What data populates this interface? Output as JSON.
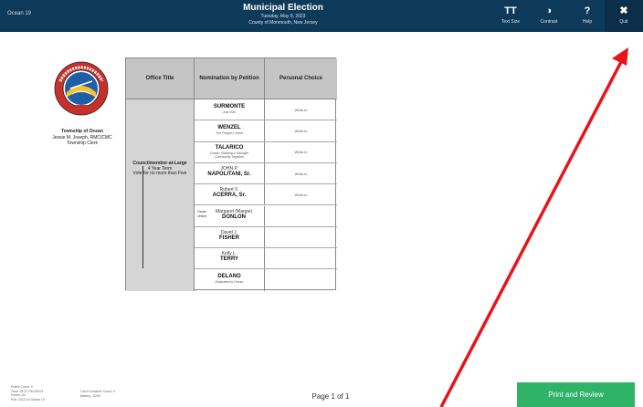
{
  "header": {
    "precinct": "Ocean 19",
    "title": "Municipal Election",
    "date": "Tuesday, May 9, 2023",
    "county": "County of Monmouth, New Jersey",
    "buttons": {
      "text_size": {
        "icon": "TT",
        "label": "Text Size"
      },
      "contrast": {
        "icon": "◑",
        "label": "Contrast"
      },
      "help": {
        "icon": "?",
        "label": "Help"
      },
      "quit": {
        "icon": "✖",
        "label": "Quit"
      }
    }
  },
  "seal": {
    "top_text": "TOWNSHIP OF OCEAN",
    "year": "1849"
  },
  "clerk": {
    "town": "Township of Ocean",
    "name": "Jessie M. Joseph, RMC/CMC",
    "title": "Township Clerk"
  },
  "ballot": {
    "headers": {
      "office": "Office Title",
      "nomination": "Nomination by Petition",
      "choice": "Personal Choice"
    },
    "office": {
      "title": "Councilmember-at-Large",
      "term": "4 Year Term",
      "instruction": "Vote for no more than Five"
    },
    "ocean_united": "Ocean United",
    "write_in": "Write-in",
    "candidates": [
      {
        "first": "",
        "last": "SURMONTE",
        "slogan": "Just Vote"
      },
      {
        "first": "",
        "last": "WENZEL",
        "slogan": "The People's Voice"
      },
      {
        "first": "",
        "last": "TALARICO",
        "slogan": "Ocean: Building a Stronger Community Together"
      },
      {
        "first": "JOHN P.",
        "last": "NAPOLITANI, Sr.",
        "slogan": ""
      },
      {
        "first": "Robert V.",
        "last": "ACERRA, Sr.",
        "slogan": ""
      },
      {
        "first": "Margaret (Margie)",
        "last": "DONLON",
        "slogan": ""
      },
      {
        "first": "David J.",
        "last": "FISHER",
        "slogan": ""
      },
      {
        "first": "Kelly L.",
        "last": "TERRY",
        "slogan": ""
      },
      {
        "first": "",
        "last": "DELANO",
        "slogan": "Dedicated to Ocean"
      }
    ]
  },
  "footer": {
    "public_count": "Public Count: 0",
    "time": "Time: 04:37 PM 5/8/23",
    "power": "Power: AC",
    "poll": "Poll: 2312-19 Ocean 19",
    "container_count": "Card Container Count: 0",
    "battery": "Battery: 100%",
    "page": "Page 1 of 1",
    "print_review": "Print and Review"
  },
  "colors": {
    "header_bg": "#0e3a5a",
    "print_button": "#2fb369",
    "arrow": "#e8141c"
  }
}
